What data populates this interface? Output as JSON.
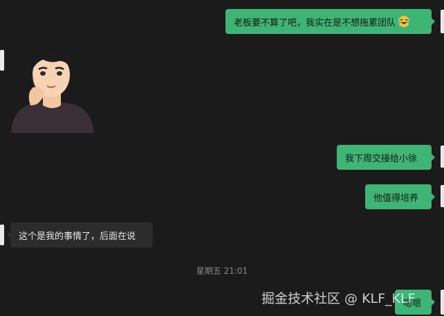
{
  "messages": [
    {
      "side": "out",
      "text": "老板要不算了吧，我实在是不想拖累团队",
      "emoji": "laughing-crying-emoji"
    },
    {
      "side": "in",
      "type": "sticker",
      "sticker_caption": "想想"
    },
    {
      "side": "out",
      "text": "我下周交接给小徐"
    },
    {
      "side": "out",
      "text": "他值得培养"
    },
    {
      "side": "in",
      "text": "这个是我的事情了，后面在说"
    },
    {
      "side": "out",
      "text": "嗯嗯"
    }
  ],
  "timestamp": "星期五 21:01",
  "watermark": "掘金技术社区 @ KLF_KLF",
  "colors": {
    "background": "#1b1b1b",
    "outgoing_bubble": "#3eb575",
    "incoming_bubble": "#2c2c2c",
    "timestamp": "#8a8a8a"
  }
}
